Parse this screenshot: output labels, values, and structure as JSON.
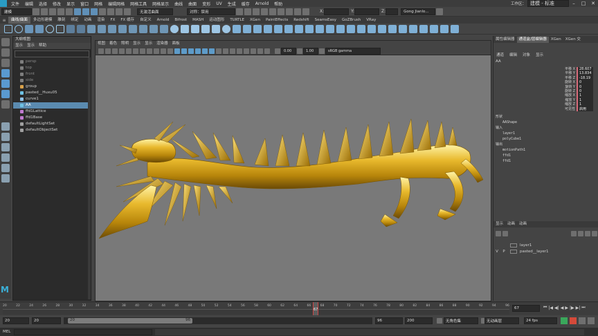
{
  "menubar": {
    "items": [
      "文件",
      "编辑",
      "选择",
      "修改",
      "显示",
      "窗口",
      "网格",
      "编辑网格",
      "网格工具",
      "网格显示",
      "曲线",
      "曲面",
      "变形",
      "UV",
      "生成",
      "缓存",
      "Arnold",
      "帮助"
    ],
    "workspace": "工作区：",
    "workspace_value": "建模 - 标准"
  },
  "statusline": {
    "mode": "建模",
    "no_live_surface": "无激活曲面",
    "symmetry": "对称：禁用",
    "x_label": "X:",
    "y_label": "Y:",
    "z_label": "Z:",
    "user": "Gong Jianlo..."
  },
  "shelf": {
    "tabs": [
      "曲线/曲面",
      "多边形建模",
      "雕刻",
      "绑定",
      "动画",
      "渲染",
      "FX",
      "FX 缓存",
      "自定义",
      "Arnold",
      "Bifrost",
      "MASH",
      "运动图形",
      "TURTLE",
      "XGen",
      "PaintEffects",
      "Redshift",
      "SeamsEasy",
      "GoZBrush",
      "VRay"
    ],
    "active_tab": "曲线/曲面"
  },
  "outliner": {
    "title": "大纲视图",
    "menu": [
      "显示",
      "显示",
      "帮助"
    ],
    "items": [
      {
        "label": "persp",
        "type": "camera",
        "selected": false
      },
      {
        "label": "top",
        "type": "camera",
        "selected": false
      },
      {
        "label": "front",
        "type": "camera",
        "selected": false
      },
      {
        "label": "side",
        "type": "camera",
        "selected": false
      },
      {
        "label": "group",
        "type": "group",
        "selected": false
      },
      {
        "label": "pasted__Huxu05",
        "type": "mesh",
        "selected": false
      },
      {
        "label": "curve1",
        "type": "curve",
        "selected": false
      },
      {
        "label": "AA",
        "type": "mesh",
        "selected": true
      },
      {
        "label": "ffd1Lattice",
        "type": "lattice",
        "selected": false
      },
      {
        "label": "ffd1Base",
        "type": "lattice",
        "selected": false
      },
      {
        "label": "defaultLightSet",
        "type": "set",
        "selected": false
      },
      {
        "label": "defaultObjectSet",
        "type": "set",
        "selected": false
      }
    ]
  },
  "viewport": {
    "menu": [
      "视图",
      "着色",
      "照明",
      "显示",
      "显示",
      "渲染器",
      "面板"
    ],
    "exposure": "0.00",
    "gamma": "1.00",
    "colorspace": "sRGB gamma"
  },
  "rightpanel": {
    "tabs": [
      "属性编辑器",
      "通道盒/层编辑器",
      "XGen",
      "XGen 交"
    ],
    "active_tab": "通道盒/层编辑器",
    "menu": [
      "通道",
      "编辑",
      "对象",
      "显示"
    ],
    "object_name": "AA",
    "attributes": [
      {
        "name": "平移 X",
        "value": "28.607"
      },
      {
        "name": "平移 Y",
        "value": "13.834"
      },
      {
        "name": "平移 Z",
        "value": "-18.19"
      },
      {
        "name": "旋转 X",
        "value": "0"
      },
      {
        "name": "旋转 Y",
        "value": "0"
      },
      {
        "name": "旋转 Z",
        "value": "0"
      },
      {
        "name": "缩放 X",
        "value": "1"
      },
      {
        "name": "缩放 Y",
        "value": "1"
      },
      {
        "name": "缩放 Z",
        "value": "1"
      },
      {
        "name": "可见性",
        "value": "启用"
      }
    ],
    "shape_header": "形状",
    "shape_name": "AAShape",
    "inputs_header": "输入",
    "inputs": [
      "layer1",
      "polyCube1"
    ],
    "outputs_header": "输出",
    "outputs": [
      "motionPath1",
      "ffd1",
      "ffd1"
    ],
    "layer_tabs": [
      "显示",
      "动画",
      "动画"
    ],
    "layers": [
      {
        "v": "",
        "p": "",
        "name": "layer1"
      },
      {
        "v": "V",
        "p": "P",
        "name": "pasted__layer1"
      }
    ]
  },
  "timeline": {
    "ticks": [
      "20",
      "22",
      "24",
      "26",
      "28",
      "30",
      "32",
      "34",
      "36",
      "38",
      "40",
      "42",
      "44",
      "46",
      "48",
      "50",
      "52",
      "54",
      "56",
      "58",
      "60",
      "62",
      "64",
      "66",
      "68",
      "70",
      "72",
      "74",
      "76",
      "78",
      "80",
      "82",
      "84",
      "86",
      "88",
      "90",
      "92",
      "94",
      "96"
    ],
    "current_frame": "67",
    "current_frame_field": "67"
  },
  "range": {
    "start": "20",
    "start2": "20",
    "inner_start": "20",
    "inner_end": "96",
    "end": "96",
    "end2": "200",
    "char_set": "无角色集",
    "anim_layer": "无动画层",
    "fps": "24 fps"
  },
  "cmdline": {
    "label": "MEL"
  }
}
